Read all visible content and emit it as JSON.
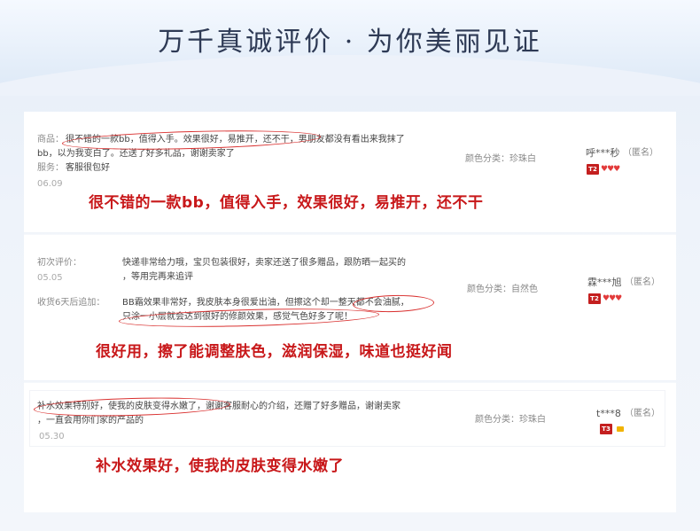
{
  "header": {
    "title": "万千真诚评价 · 为你美丽见证"
  },
  "reviews": [
    {
      "label_goods": "商品：",
      "line1": "很不错的一款bb，值得入手。效果很好，易推开，还不干，男朋友都没有看出来我抹了",
      "line2": "bb，以为我变白了。还送了好多礼品，谢谢卖家了",
      "label_service": "服务：",
      "service_text": "客服很包好",
      "date": "06.09",
      "color_attr": "颜色分类：珍珠白",
      "user": "呼***秒",
      "anon": "（匿名）",
      "level": "T2",
      "hearts": "♥♥♥",
      "highlight": "很不错的一款bb，值得入手，效果很好，易推开，还不干"
    },
    {
      "label_initial": "初次评价：",
      "initial_line1": "快递非常给力哦，宝贝包装很好，卖家还送了很多赠品，跟防晒一起买的",
      "initial_line2": "，等用完再来追评",
      "date": "05.05",
      "label_followup": "收货6天后追加：",
      "followup_line1": "BB霜效果非常好，我皮肤本身很爱出油，但擦这个却一整天都不会油腻，",
      "followup_line2": "只涂一小层就会达到很好的修颜效果，感觉气色好多了呢！",
      "color_attr": "颜色分类：自然色",
      "user": "霖***旭",
      "anon": "（匿名）",
      "level": "T2",
      "hearts": "♥♥♥",
      "highlight": "很好用，擦了能调整肤色，滋润保湿，味道也挺好闻"
    },
    {
      "line1": "补水效果特别好，使我的皮肤变得水嫩了，谢谢客服耐心的介绍，还赠了好多赠品，谢谢卖家",
      "line2": "，一直会用你们家的产品的",
      "date": "05.30",
      "color_attr": "颜色分类：珍珠白",
      "user": "t***8",
      "anon": "（匿名）",
      "level": "T3",
      "highlight": "补水效果好，使我的皮肤变得水嫩了"
    }
  ],
  "colors": {
    "accent_red": "#c8181a",
    "circle_red": "#d9302f",
    "title": "#2e3a55"
  },
  "icons": [
    "heart-icon",
    "diamond-icon",
    "level-badge"
  ]
}
